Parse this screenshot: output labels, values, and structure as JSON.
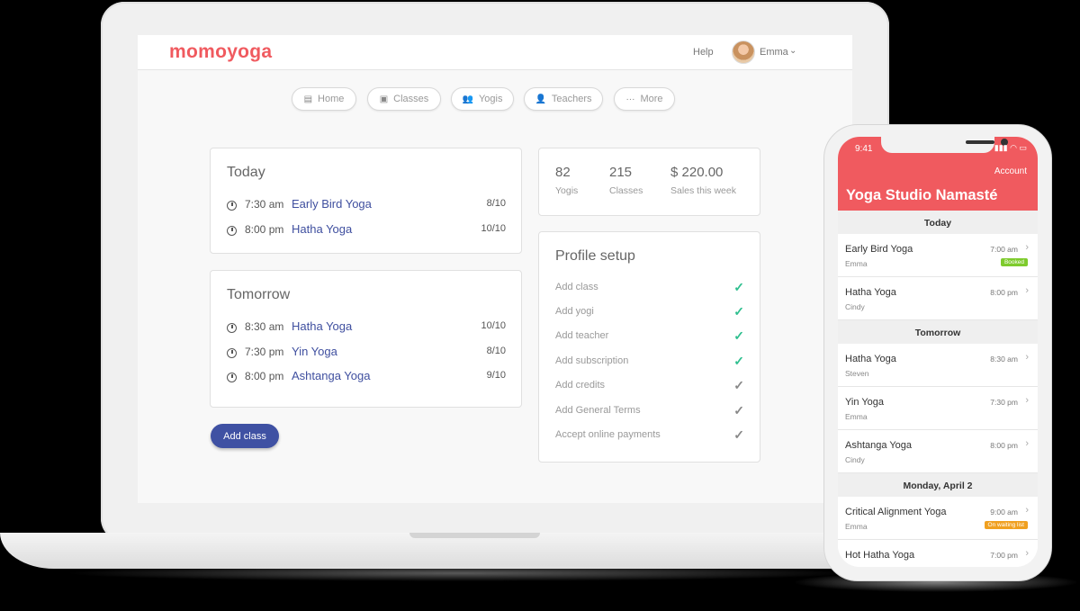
{
  "colors": {
    "brand": "#f05a5f",
    "accent": "#3f51a3",
    "check_done": "#2fbf8f",
    "check_pending": "#888888",
    "booked": "#7ecb2d",
    "waiting": "#f0a020"
  },
  "laptop": {
    "logo": "momoyoga",
    "help": "Help",
    "user": "Emma",
    "nav": [
      {
        "label": "Home",
        "icon": "home-icon",
        "glyph": "▤"
      },
      {
        "label": "Classes",
        "icon": "calendar-icon",
        "glyph": "▣"
      },
      {
        "label": "Yogis",
        "icon": "users-icon",
        "glyph": "👥"
      },
      {
        "label": "Teachers",
        "icon": "user-icon",
        "glyph": "👤"
      },
      {
        "label": "More",
        "icon": "more-icon",
        "glyph": "···"
      }
    ],
    "today": {
      "title": "Today",
      "classes": [
        {
          "time": "7:30 am",
          "name": "Early Bird Yoga",
          "count": "8/10"
        },
        {
          "time": "8:00 pm",
          "name": "Hatha Yoga",
          "count": "10/10"
        }
      ]
    },
    "tomorrow": {
      "title": "Tomorrow",
      "classes": [
        {
          "time": "8:30 am",
          "name": "Hatha Yoga",
          "count": "10/10"
        },
        {
          "time": "7:30 pm",
          "name": "Yin Yoga",
          "count": "8/10"
        },
        {
          "time": "8:00 pm",
          "name": "Ashtanga Yoga",
          "count": "9/10"
        }
      ]
    },
    "add_class": "Add class",
    "stats": [
      {
        "value": "82",
        "label": "Yogis"
      },
      {
        "value": "215",
        "label": "Classes"
      },
      {
        "value": "$ 220.00",
        "label": "Sales this week"
      }
    ],
    "profile_setup": {
      "title": "Profile setup",
      "items": [
        {
          "label": "Add class",
          "done": true
        },
        {
          "label": "Add yogi",
          "done": true
        },
        {
          "label": "Add teacher",
          "done": true
        },
        {
          "label": "Add subscription",
          "done": true
        },
        {
          "label": "Add credits",
          "done": false
        },
        {
          "label": "Add General Terms",
          "done": false
        },
        {
          "label": "Accept online payments",
          "done": false
        }
      ]
    }
  },
  "phone": {
    "time": "9:41",
    "account": "Account",
    "title": "Yoga Studio Namasté",
    "sections": [
      {
        "title": "Today",
        "items": [
          {
            "name": "Early Bird Yoga",
            "teacher": "Emma",
            "time": "7:00 am",
            "badge": "Booked",
            "badge_type": "booked"
          },
          {
            "name": "Hatha Yoga",
            "teacher": "Cindy",
            "time": "8:00 pm"
          }
        ]
      },
      {
        "title": "Tomorrow",
        "items": [
          {
            "name": "Hatha Yoga",
            "teacher": "Steven",
            "time": "8:30 am"
          },
          {
            "name": "Yin Yoga",
            "teacher": "Emma",
            "time": "7:30 pm"
          },
          {
            "name": "Ashtanga Yoga",
            "teacher": "Cindy",
            "time": "8:00 pm"
          }
        ]
      },
      {
        "title": "Monday, April 2",
        "items": [
          {
            "name": "Critical Alignment Yoga",
            "teacher": "Emma",
            "time": "9:00 am",
            "badge": "On waiting list",
            "badge_type": "waiting"
          },
          {
            "name": "Hot Hatha Yoga",
            "teacher": "",
            "time": "7:00 pm"
          }
        ]
      }
    ]
  }
}
